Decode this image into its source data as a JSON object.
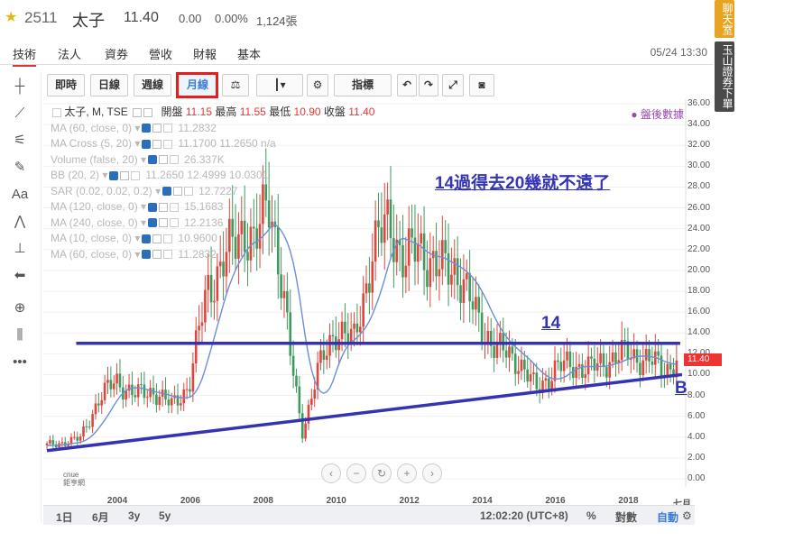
{
  "stock": {
    "code": "2511",
    "name": "太子",
    "price": "11.40",
    "change": "0.00",
    "change_pct": "0.00%",
    "volume": "1,124張"
  },
  "nav": {
    "tabs": [
      "技術",
      "法人",
      "資券",
      "營收",
      "財報",
      "基本"
    ],
    "datetime": "05/24 13:30"
  },
  "side": {
    "chat": "聊天室",
    "ad": "玉山證券下單"
  },
  "toolbar": {
    "timeframes": [
      "即時",
      "日線",
      "週線",
      "月線"
    ],
    "indicators_label": "指標"
  },
  "legend": {
    "main_label": "太子, M, TSE",
    "open_label": "開盤",
    "open": "11.15",
    "high_label": "最高",
    "high": "11.55",
    "low_label": "最低",
    "low": "10.90",
    "close_label": "收盤",
    "close": "11.40",
    "rows": [
      {
        "name": "MA (60, close, 0)",
        "value": "11.2832"
      },
      {
        "name": "MA Cross (5, 20)",
        "value": "11.1700  11.2650  n/a"
      },
      {
        "name": "Volume (false, 20)",
        "value": "26.337K"
      },
      {
        "name": "BB (20, 2)",
        "value": "11.2650  12.4999  10.0301"
      },
      {
        "name": "SAR (0.02, 0.02, 0.2)",
        "value": "12.7227"
      },
      {
        "name": "MA (120, close, 0)",
        "value": "15.1683"
      },
      {
        "name": "MA (240, close, 0)",
        "value": "12.2136"
      },
      {
        "name": "MA (10, close, 0)",
        "value": "10.9600"
      },
      {
        "name": "MA (60, close, 0)",
        "value": "11.2832"
      }
    ]
  },
  "after_hours": "● 盤後數據",
  "annotations": {
    "main": "14過得去20幾就不遠了",
    "level": "14",
    "point": "B"
  },
  "price_tag": "11.40",
  "chart_data": {
    "type": "candlestick",
    "y_ticks": [
      "36.00",
      "34.00",
      "32.00",
      "30.00",
      "28.00",
      "26.00",
      "24.00",
      "22.00",
      "20.00",
      "18.00",
      "16.00",
      "14.00",
      "12.00",
      "10.00",
      "8.00",
      "6.00",
      "4.00",
      "2.00",
      "0.00"
    ],
    "x_ticks": [
      "2004",
      "2006",
      "2008",
      "2010",
      "2012",
      "2014",
      "2016",
      "2018",
      "七月"
    ],
    "ylim": [
      0,
      36
    ],
    "resistance_level": 13,
    "support_line": {
      "start": {
        "year": 2002.1,
        "value": 2.7
      },
      "end": {
        "year": 2019.5,
        "value": 10.0
      }
    },
    "close_series": [
      {
        "year": 2002.1,
        "value": 3.2
      },
      {
        "year": 2003.0,
        "value": 3.8
      },
      {
        "year": 2003.5,
        "value": 7.5
      },
      {
        "year": 2004.0,
        "value": 9.5
      },
      {
        "year": 2004.5,
        "value": 8.0
      },
      {
        "year": 2005.0,
        "value": 8.5
      },
      {
        "year": 2005.5,
        "value": 7.0
      },
      {
        "year": 2006.0,
        "value": 9.0
      },
      {
        "year": 2006.5,
        "value": 18.5
      },
      {
        "year": 2007.0,
        "value": 21.0
      },
      {
        "year": 2007.5,
        "value": 24.5
      },
      {
        "year": 2007.8,
        "value": 22.0
      },
      {
        "year": 2008.2,
        "value": 27.5
      },
      {
        "year": 2008.5,
        "value": 19.5
      },
      {
        "year": 2008.8,
        "value": 11.0
      },
      {
        "year": 2009.1,
        "value": 4.5
      },
      {
        "year": 2009.5,
        "value": 10.0
      },
      {
        "year": 2010.0,
        "value": 14.5
      },
      {
        "year": 2010.5,
        "value": 13.0
      },
      {
        "year": 2011.0,
        "value": 21.5
      },
      {
        "year": 2011.5,
        "value": 25.0
      },
      {
        "year": 2011.9,
        "value": 20.5
      },
      {
        "year": 2012.3,
        "value": 22.5
      },
      {
        "year": 2012.8,
        "value": 20.0
      },
      {
        "year": 2013.3,
        "value": 20.5
      },
      {
        "year": 2013.8,
        "value": 16.0
      },
      {
        "year": 2014.4,
        "value": 12.5
      },
      {
        "year": 2015.0,
        "value": 11.5
      },
      {
        "year": 2015.5,
        "value": 8.5
      },
      {
        "year": 2016.0,
        "value": 10.5
      },
      {
        "year": 2016.5,
        "value": 11.0
      },
      {
        "year": 2017.0,
        "value": 10.5
      },
      {
        "year": 2017.5,
        "value": 11.5
      },
      {
        "year": 2018.0,
        "value": 12.0
      },
      {
        "year": 2018.5,
        "value": 11.5
      },
      {
        "year": 2019.0,
        "value": 10.5
      },
      {
        "year": 2019.4,
        "value": 11.4
      }
    ]
  },
  "bottom": {
    "ranges": [
      "1日",
      "6月",
      "3y",
      "5y"
    ],
    "time": "12:02:20 (UTC+8)",
    "pct": "%",
    "log": "對數",
    "auto": "自動"
  }
}
